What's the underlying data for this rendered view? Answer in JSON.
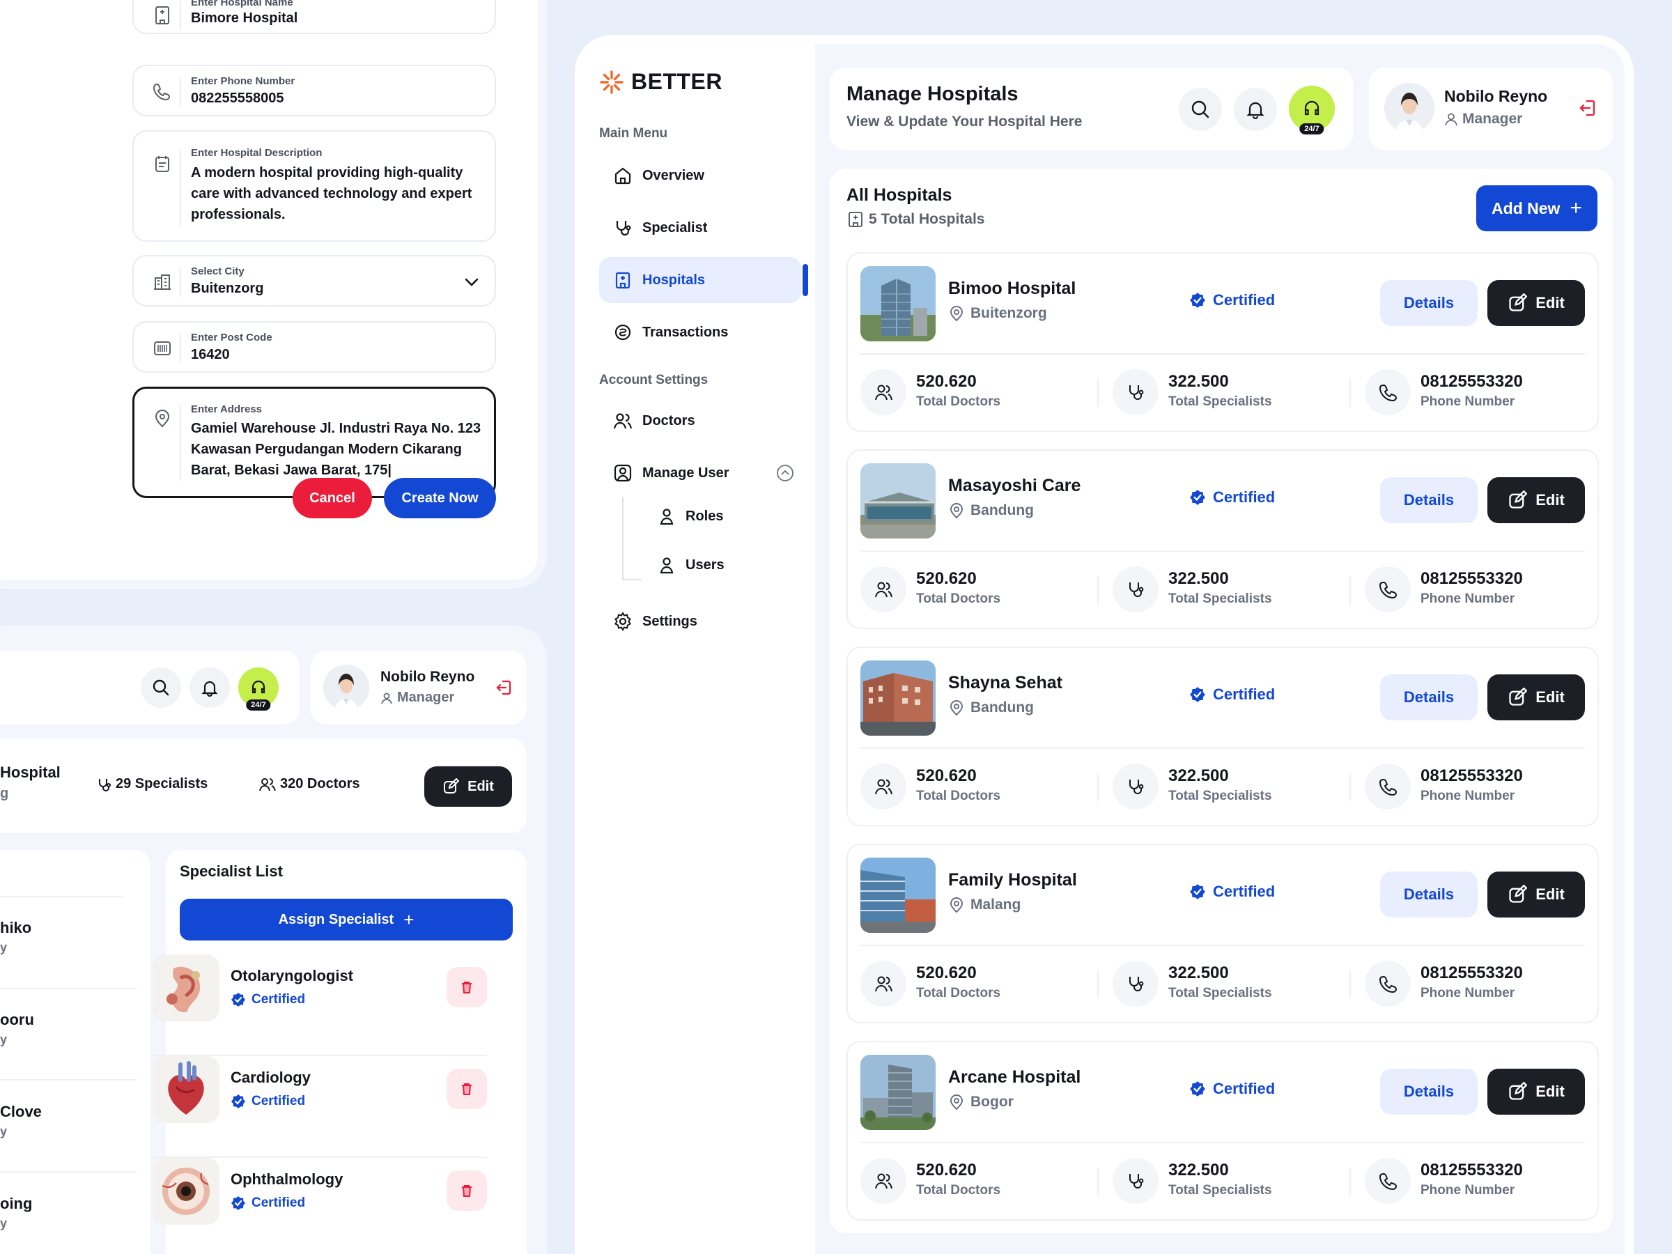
{
  "form": {
    "hospital_name": {
      "label": "Enter Hospital Name",
      "value": "Bimore Hospital"
    },
    "phone": {
      "label": "Enter Phone Number",
      "value": "082255558005"
    },
    "description": {
      "label": "Enter Hospital Description",
      "line1": "A modern hospital providing high-quality",
      "line2": "care with advanced technology and expert",
      "line3": "professionals."
    },
    "city": {
      "label": "Select City",
      "value": "Buitenzorg"
    },
    "post_code": {
      "label": "Enter Post Code",
      "value": "16420"
    },
    "address": {
      "label": "Enter Address",
      "line1": "Gamiel Warehouse Jl. Industri Raya No. 123",
      "line2": "Kawasan Pergudangan Modern Cikarang",
      "line3": "Barat, Bekasi Jawa Barat, 175|"
    },
    "cancel_label": "Cancel",
    "create_label": "Create Now"
  },
  "detail": {
    "user_name": "Nobilo Reyno",
    "user_role": "Manager",
    "support_badge": "24/7",
    "hospital_partial": "Hospital",
    "hospital_partial_sub": "g",
    "specialists_count": "29 Specialists",
    "doctors_count": "320 Doctors",
    "edit_label": "Edit",
    "doctor_fragments": [
      {
        "name": "hiko",
        "sub": "y"
      },
      {
        "name": "ooru",
        "sub": "y"
      },
      {
        "name": "Clove",
        "sub": "y"
      },
      {
        "name": "oing",
        "sub": "y"
      }
    ],
    "specialist_list_title": "Specialist List",
    "assign_label": "Assign Specialist",
    "specialists": [
      {
        "name": "Otolaryngologist",
        "status": "Certified"
      },
      {
        "name": "Cardiology",
        "status": "Certified"
      },
      {
        "name": "Ophthalmology",
        "status": "Certified"
      }
    ]
  },
  "app": {
    "brand": "BETTER",
    "brand_color": "#f26a2a",
    "accent_color": "#1348d4",
    "menu_section": "Main Menu",
    "account_section": "Account Settings",
    "nav": [
      {
        "label": "Overview",
        "icon": "home-icon"
      },
      {
        "label": "Specialist",
        "icon": "stethoscope-icon"
      },
      {
        "label": "Hospitals",
        "icon": "hospital-icon",
        "active": true
      },
      {
        "label": "Transactions",
        "icon": "transactions-icon"
      }
    ],
    "account_nav": [
      {
        "label": "Doctors",
        "icon": "doctors-icon"
      },
      {
        "label": "Manage User",
        "icon": "manage-user-icon"
      },
      {
        "label": "Roles",
        "icon": "user-icon"
      },
      {
        "label": "Users",
        "icon": "user-icon"
      },
      {
        "label": "Settings",
        "icon": "gear-icon"
      }
    ],
    "header": {
      "title": "Manage Hospitals",
      "subtitle": "View & Update Your Hospital Here",
      "support_badge": "24/7",
      "user_name": "Nobilo Reyno",
      "user_role": "Manager"
    },
    "list": {
      "title": "All Hospitals",
      "count": "5 Total Hospitals",
      "add_label": "Add New"
    },
    "hospitals": [
      {
        "name": "Bimoo Hospital",
        "city": "Buitenzorg",
        "status": "Certified",
        "details": "Details",
        "edit": "Edit",
        "doctors": "520.620",
        "doctors_label": "Total Doctors",
        "specialists": "322.500",
        "specialists_label": "Total Specialists",
        "phone": "08125553320",
        "phone_label": "Phone Number"
      },
      {
        "name": "Masayoshi Care",
        "city": "Bandung",
        "status": "Certified",
        "details": "Details",
        "edit": "Edit",
        "doctors": "520.620",
        "doctors_label": "Total Doctors",
        "specialists": "322.500",
        "specialists_label": "Total Specialists",
        "phone": "08125553320",
        "phone_label": "Phone Number"
      },
      {
        "name": "Shayna Sehat",
        "city": "Bandung",
        "status": "Certified",
        "details": "Details",
        "edit": "Edit",
        "doctors": "520.620",
        "doctors_label": "Total Doctors",
        "specialists": "322.500",
        "specialists_label": "Total Specialists",
        "phone": "08125553320",
        "phone_label": "Phone Number"
      },
      {
        "name": "Family Hospital",
        "city": "Malang",
        "status": "Certified",
        "details": "Details",
        "edit": "Edit",
        "doctors": "520.620",
        "doctors_label": "Total Doctors",
        "specialists": "322.500",
        "specialists_label": "Total Specialists",
        "phone": "08125553320",
        "phone_label": "Phone Number"
      },
      {
        "name": "Arcane Hospital",
        "city": "Bogor",
        "status": "Certified",
        "details": "Details",
        "edit": "Edit",
        "doctors": "520.620",
        "doctors_label": "Total Doctors",
        "specialists": "322.500",
        "specialists_label": "Total Specialists",
        "phone": "08125553320",
        "phone_label": "Phone Number"
      }
    ]
  }
}
